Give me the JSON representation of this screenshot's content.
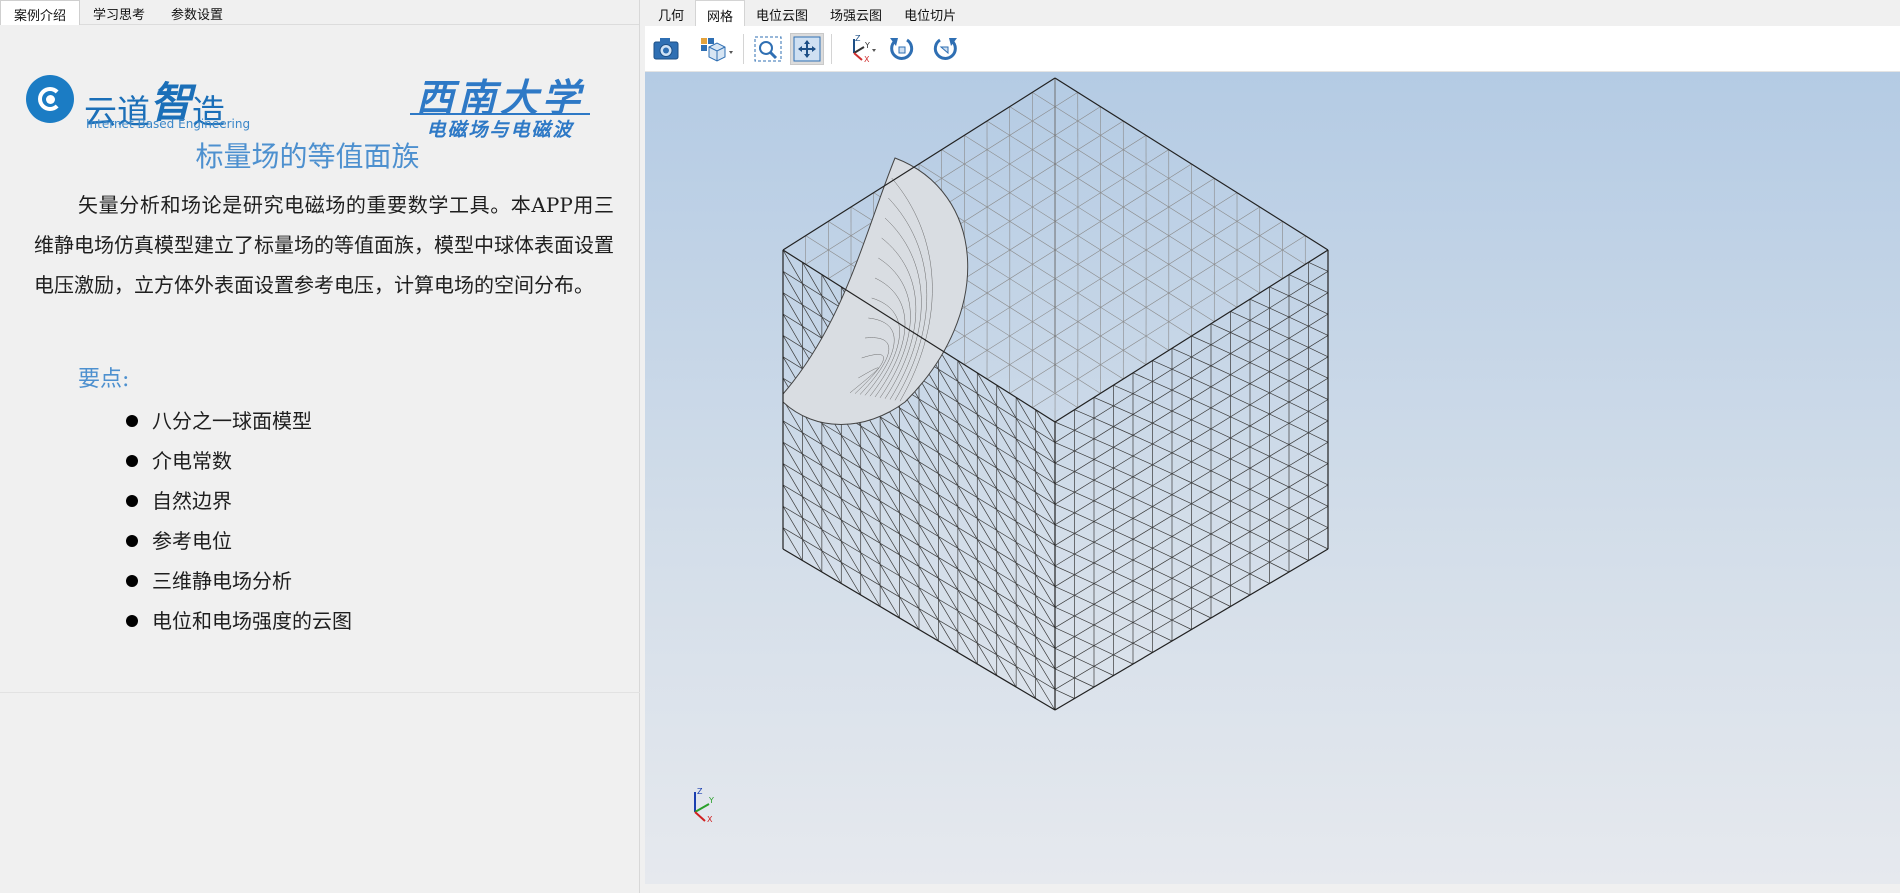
{
  "left_tabs": [
    "案例介绍",
    "学习思考",
    "参数设置"
  ],
  "logo_yundao": {
    "text_a": "云道",
    "text_b": "智",
    "text_c": "造",
    "en": "Internet Based Engineering"
  },
  "logo_swu": {
    "name": "西南大学",
    "course": "电磁场与电磁波"
  },
  "page_title": "标量场的等值面族",
  "intro": "矢量分析和场论是研究电磁场的重要数学工具。本APP用三维静电场仿真模型建立了标量场的等值面族，模型中球体表面设置电压激励，立方体外表面设置参考电压，计算电场的空间分布。",
  "key_points": {
    "label": "要点:",
    "items": [
      "八分之一球面模型",
      "介电常数",
      "自然边界",
      "参考电位",
      "三维静电场分析",
      "电位和电场强度的云图"
    ]
  },
  "right_tabs": [
    "几何",
    "网格",
    "电位云图",
    "场强云图",
    "电位切片"
  ],
  "active_right_tab": "网格",
  "toolbar": [
    "camera-icon",
    "view-cube-icon",
    "zoom-box-icon",
    "pan-fit-icon",
    "axis-orientation-icon",
    "rotate-ccw-icon",
    "rotate-cw-icon"
  ],
  "axis_labels": {
    "x": "X",
    "y": "Y",
    "z": "Z"
  },
  "colors": {
    "accent_blue": "#4d90cf",
    "logo_blue": "#1b6fb8",
    "mesh_line": "#3a3a3a"
  }
}
